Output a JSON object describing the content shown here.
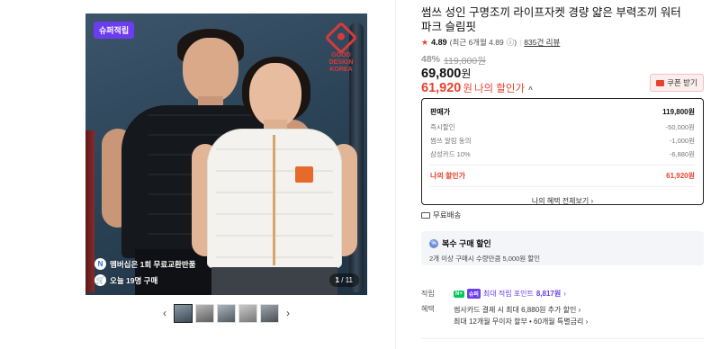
{
  "gallery": {
    "badge": "슈퍼적립",
    "logo_lines": [
      "GOOD",
      "DESIGN",
      "KOREA"
    ],
    "overlay_line1": "멤버십은 1회 무료교환반품",
    "overlay_line2": "오늘 19명 구매",
    "counter_current": "1",
    "counter_total": "11",
    "thumbnail_count": 5,
    "active_thumbnail": 1
  },
  "product": {
    "title": "썸쓰 성인 구명조끼 라이프자켓 경량 얇은 부력조끼 워터파크 슬림핏",
    "rating": "4.89",
    "rating_recent": "(최근 6개월 4.89",
    "review_count": "835건 리뷰",
    "discount_pct": "48%",
    "original_price": "119,800원",
    "sale_price": "69,800",
    "my_price": "61,920",
    "currency_unit": "원",
    "my_price_label": "나의 할인가",
    "coupon_button": "쿠폰 받기"
  },
  "price_box": {
    "head_label": "판매가",
    "head_value": "119,800원",
    "rows": [
      {
        "label": "즉시할인",
        "value": "-50,000원"
      },
      {
        "label": "썸쓰 알림 동의",
        "value": "-1,000원"
      },
      {
        "label": "삼성카드 10%",
        "value": "-6,880원"
      }
    ],
    "my_label": "나의 할인가",
    "my_value": "61,920원",
    "benefit_link": "나의 혜택 전체보기"
  },
  "shipping": {
    "label": "무료배송"
  },
  "multi_buy": {
    "title": "복수 구매 할인",
    "desc": "2개 이상 구매시 수량만큼 5,000원 할인"
  },
  "points": {
    "label": "적립",
    "npay": "N+",
    "super": "슈퍼",
    "text": "최대 적립 포인트",
    "amount": "8,817원"
  },
  "benefit": {
    "label": "혜택",
    "line1": "썸사카드 결제 시 최대 6,880원 추가 할인",
    "line2": "최대 12개월 무이자 할부 • 60개월 특별금리"
  },
  "colors": {
    "accent_red": "#e8422f",
    "super_purple": "#6b3cf0",
    "npay_green": "#03c75a"
  }
}
